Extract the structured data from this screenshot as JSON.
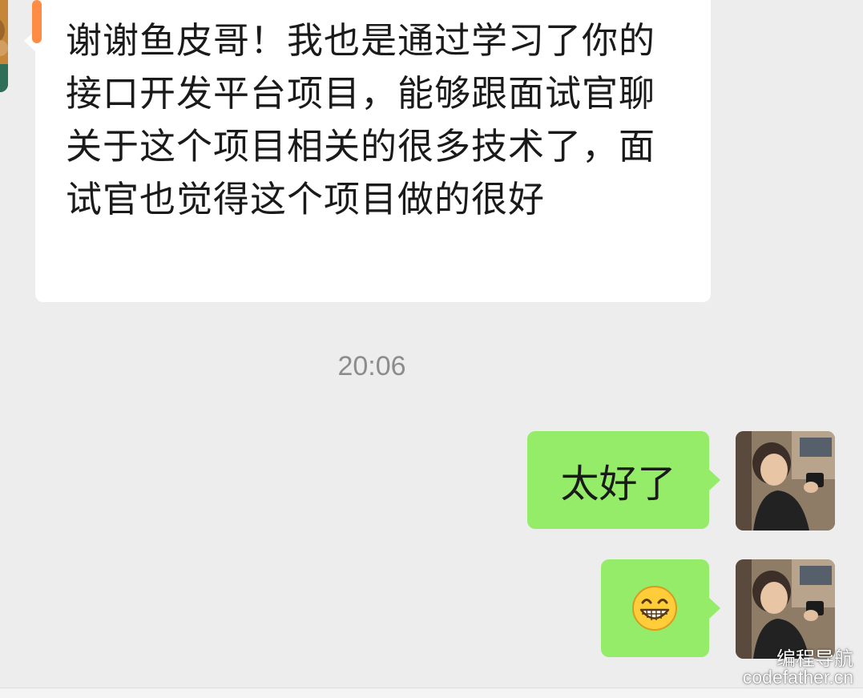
{
  "chat": {
    "messages": [
      {
        "sender": "other",
        "text": "谢谢鱼皮哥！我也是通过学习了你的接口开发平台项目，能够跟面试官聊关于这个项目相关的很多技术了，面试官也觉得这个项目做的很好"
      },
      {
        "sender": "self",
        "text": "太好了"
      },
      {
        "sender": "self",
        "emoji": "grinning-face-icon"
      }
    ],
    "timestamp": "20:06"
  },
  "watermark": {
    "cn": "编程导航",
    "en": "codefather.cn"
  },
  "colors": {
    "background": "#ededed",
    "incoming_bubble": "#ffffff",
    "outgoing_bubble": "#95ec69",
    "timestamp": "#8c8c8c",
    "scroll_marker": "#ff8c45"
  }
}
